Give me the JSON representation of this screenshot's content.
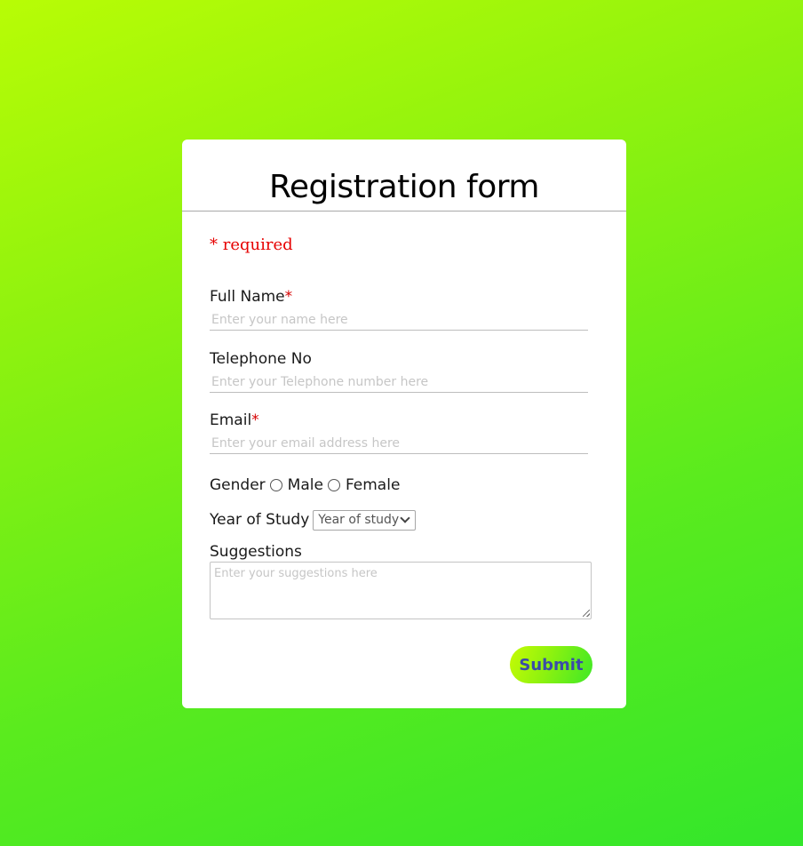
{
  "form": {
    "title": "Registration form",
    "required_note": "* required",
    "full_name": {
      "label": "Full Name",
      "required_mark": "*",
      "placeholder": "Enter your name here"
    },
    "telephone": {
      "label": "Telephone No",
      "placeholder": "Enter your Telephone number here"
    },
    "email": {
      "label": "Email",
      "required_mark": "*",
      "placeholder": "Enter your email address here"
    },
    "gender": {
      "label": "Gender",
      "options": [
        "Male",
        "Female"
      ]
    },
    "year_of_study": {
      "label": "Year of Study",
      "selected": "Year of study"
    },
    "suggestions": {
      "label": "Suggestions",
      "placeholder": "Enter your suggestions here"
    },
    "submit_label": "Submit"
  },
  "colors": {
    "background_start": "#b8fc05",
    "background_end": "#33e62b",
    "required_red": "#e60000",
    "submit_text": "#3b4ca8"
  }
}
